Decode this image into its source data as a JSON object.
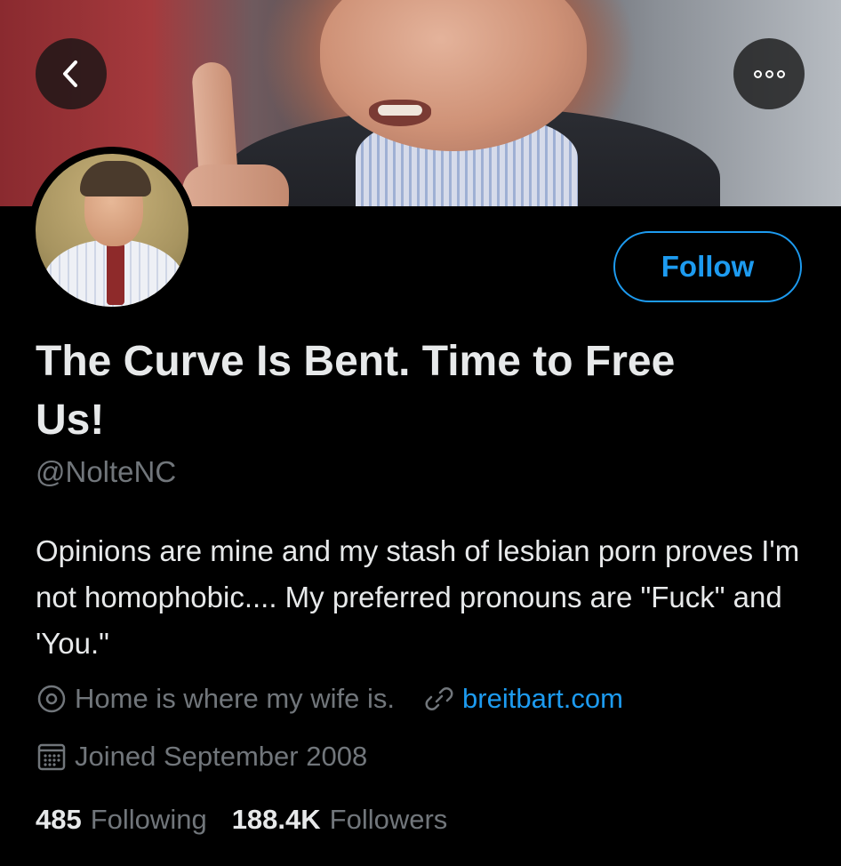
{
  "header": {
    "back_icon": "chevron-left-icon",
    "more_icon": "more-horizontal-icon"
  },
  "profile": {
    "display_name": "The Curve Is Bent. Time to Free Us!",
    "handle": "@NolteNC",
    "bio": "Opinions are mine and my stash of lesbian porn proves I'm not homophobic.... My preferred pronouns are \"Fuck\" and 'You.\"",
    "follow_label": "Follow",
    "location": "Home is where my wife is.",
    "website": "breitbart.com",
    "joined": "Joined September 2008",
    "following_count": "485",
    "following_label": "Following",
    "followers_count": "188.4K",
    "followers_label": "Followers"
  },
  "colors": {
    "background": "#000000",
    "accent": "#1d9bf0",
    "primary_text": "#e7e9ea",
    "secondary_text": "#71767b"
  }
}
